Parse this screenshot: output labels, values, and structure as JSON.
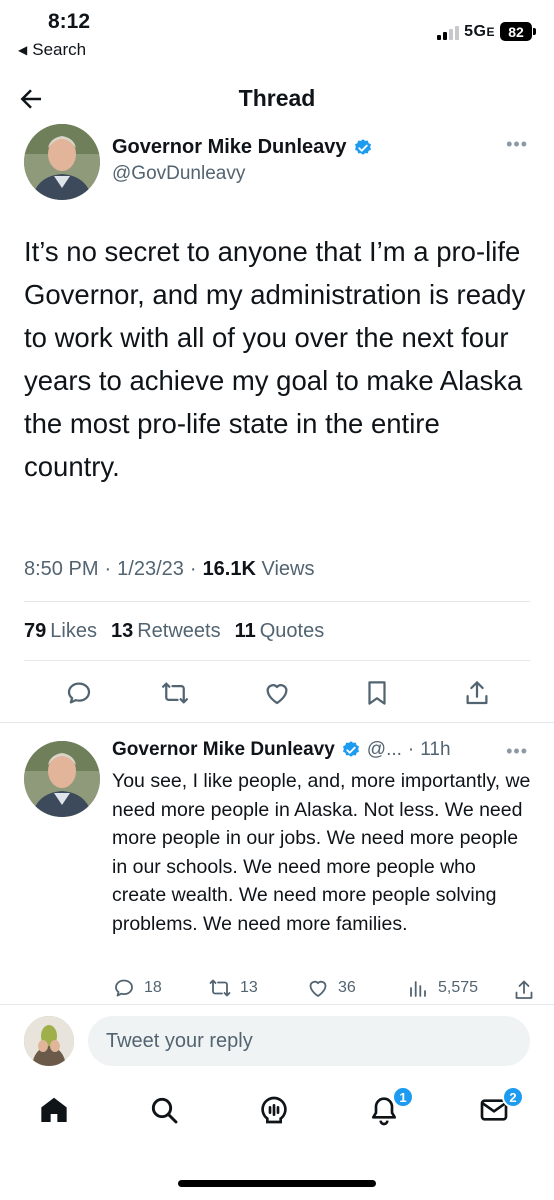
{
  "status_bar": {
    "time": "8:12",
    "back_label": "Search",
    "network": "5G",
    "network_suffix": "E",
    "battery": "82",
    "signal_bars_on": 2,
    "signal_bars_total": 4
  },
  "header": {
    "title": "Thread"
  },
  "tweet": {
    "name": "Governor Mike Dunleavy",
    "handle": "@GovDunleavy",
    "text": "It’s no secret to anyone that I’m a pro-life Governor, and my administration is ready to work with all of you over the next four years to achieve my goal to make Alaska the most pro-life state in the entire country.",
    "time": "8:50 PM",
    "date": "1/23/23",
    "views": "16.1K",
    "views_label": "Views",
    "separator": "·",
    "likes": "79",
    "likes_label": "Likes",
    "retweets": "13",
    "retweets_label": "Retweets",
    "quotes": "11",
    "quotes_label": "Quotes"
  },
  "reply": {
    "name": "Governor Mike Dunleavy",
    "handle": "@...",
    "separator": "·",
    "time": "11h",
    "text": "You see, I like people, and, more importantly, we need more people in Alaska. Not less. We need more people in our jobs. We need more people in our schools. We need more people who create wealth. We need more people solving problems. We need more families.",
    "replies": "18",
    "retweets": "13",
    "likes": "36",
    "views": "5,575"
  },
  "compose": {
    "placeholder": "Tweet your reply"
  },
  "nav": {
    "notifications_badge": "1",
    "messages_badge": "2"
  },
  "colors": {
    "accent": "#1d9bf0",
    "text": "#0f1419",
    "secondary": "#536471"
  },
  "icons": [
    "back-arrow-icon",
    "verified-badge-icon",
    "more-icon",
    "reply-icon",
    "retweet-icon",
    "like-icon",
    "bookmark-icon",
    "share-icon",
    "views-icon",
    "home-icon",
    "search-icon",
    "spaces-icon",
    "notifications-icon",
    "messages-icon"
  ]
}
